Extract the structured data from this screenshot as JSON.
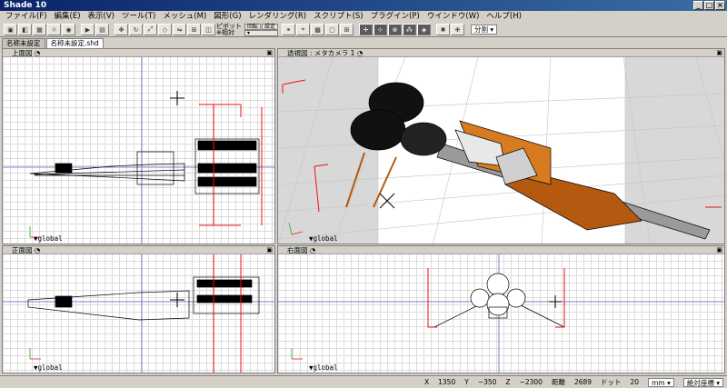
{
  "window": {
    "title": "Shade 10",
    "btn_min": "_",
    "btn_max": "□",
    "btn_close": "×"
  },
  "menu": [
    "ファイル(F)",
    "編集(E)",
    "表示(V)",
    "ツール(T)",
    "メッシュ(M)",
    "図形(G)",
    "レンダリング(R)",
    "スクリプト(S)",
    "プラグイン(P)",
    "ウインドウ(W)",
    "ヘルプ(H)"
  ],
  "toolbar": {
    "pivot_label": "ピボット",
    "pivot_sub": "※相対",
    "pivot_rotate": "回転",
    "pivot_set": "設定",
    "split_select": "分割 ▾"
  },
  "tabs": [
    "名称未設定",
    "名称未設定.shd"
  ],
  "viewports": {
    "top": {
      "title": "上面図",
      "coord": "▼global"
    },
    "persp": {
      "title": "透視図 : メタカメラ 1",
      "coord": "▼global"
    },
    "front": {
      "title": "正面図",
      "coord": "▼global"
    },
    "right": {
      "title": "右面図",
      "coord": "▼global"
    }
  },
  "status": {
    "x_label": "X",
    "x_val": "1350",
    "y_label": "Y",
    "y_val": "−350",
    "z_label": "Z",
    "z_val": "−2300",
    "dist_label": "距離",
    "dist_val": "2689",
    "dot_label": "ドット",
    "dot_val": "20",
    "unit": "mm ▾",
    "mode": "絶対座標 ▾"
  }
}
